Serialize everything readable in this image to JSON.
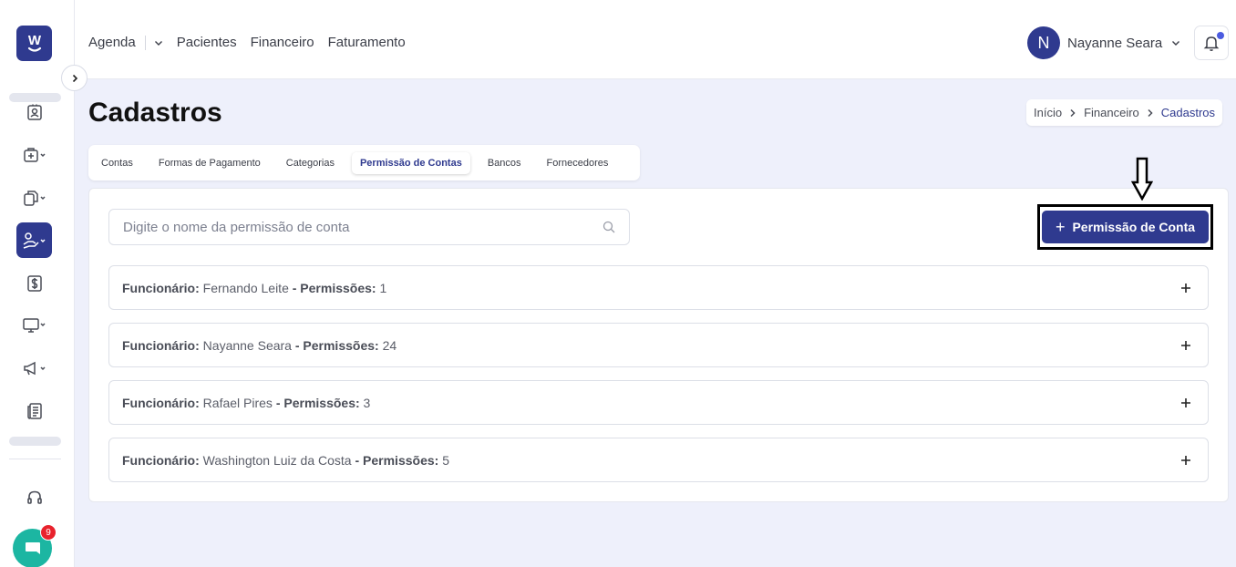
{
  "brand": {
    "logo_letter": "W",
    "accent": "#2f3a8f"
  },
  "sidebar": {
    "items": [
      {
        "icon": "contact-card-icon"
      },
      {
        "icon": "medical-kit-icon"
      },
      {
        "icon": "documents-icon"
      },
      {
        "icon": "hand-coins-icon",
        "active": true
      },
      {
        "icon": "dollar-sign-icon"
      },
      {
        "icon": "monitor-icon"
      },
      {
        "icon": "megaphone-icon"
      },
      {
        "icon": "newspaper-icon"
      }
    ],
    "support_icon": "headset-icon",
    "chat_badge": "9"
  },
  "topnav": {
    "items": [
      "Agenda",
      "Pacientes",
      "Financeiro",
      "Faturamento"
    ]
  },
  "user": {
    "initial": "N",
    "name": "Nayanne Seara"
  },
  "page": {
    "title": "Cadastros"
  },
  "breadcrumb": [
    "Início",
    "Financeiro",
    "Cadastros"
  ],
  "tabs": [
    {
      "label": "Contas"
    },
    {
      "label": "Formas de Pagamento"
    },
    {
      "label": "Categorias"
    },
    {
      "label": "Permissão de Contas",
      "active": true
    },
    {
      "label": "Bancos"
    },
    {
      "label": "Fornecedores"
    }
  ],
  "search": {
    "placeholder": "Digite o nome da permissão de conta"
  },
  "add_button": {
    "plus": "+",
    "label": "Permissão de Conta"
  },
  "rows": [
    {
      "employee_label": "Funcionário:",
      "name": "Fernando Leite",
      "perm_label": "- Permissões:",
      "count": "1"
    },
    {
      "employee_label": "Funcionário:",
      "name": "Nayanne Seara",
      "perm_label": "- Permissões:",
      "count": "24"
    },
    {
      "employee_label": "Funcionário:",
      "name": "Rafael Pires",
      "perm_label": "- Permissões:",
      "count": "3"
    },
    {
      "employee_label": "Funcionário:",
      "name": "Washington Luiz da Costa",
      "perm_label": "- Permissões:",
      "count": "5"
    }
  ]
}
